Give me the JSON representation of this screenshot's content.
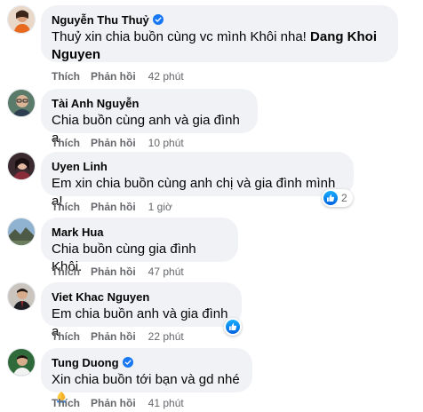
{
  "ui": {
    "like_label": "Thích",
    "reply_label": "Phản hồi"
  },
  "colors": {
    "bubble": "#f0f2f5",
    "meta": "#65676b",
    "verified": "#1877f2"
  },
  "comments": [
    {
      "name": "Nguyễn Thu Thuỷ",
      "verified": true,
      "text_before": "Thuỷ xin chia buồn cùng vc mình Khôi nha! ",
      "mention_line1": "Dang Khoi",
      "mention_line2": "Nguyen",
      "time": "42 phút",
      "avatar": "woman-orange-dress-avatar"
    },
    {
      "name": "Tài Anh Nguyễn",
      "verified": false,
      "text": "Chia buồn cùng anh và gia đình ạ",
      "time": "10 phút",
      "avatar": "man-glasses-avatar"
    },
    {
      "name": "Uyen Linh",
      "verified": false,
      "text": "Em xin chia buồn cùng anh chị và gia đình mình ạ!",
      "time": "1 giờ",
      "reaction_count": "2",
      "avatar": "woman-singer-avatar"
    },
    {
      "name": "Mark Hua",
      "verified": false,
      "text": "Chia buồn cùng gia đình Khôi.",
      "time": "47 phút",
      "avatar": "landscape-avatar"
    },
    {
      "name": "Viet Khac Nguyen",
      "verified": false,
      "text": "Em chia buồn anh và gia đình ạ",
      "time": "22 phút",
      "has_reaction": true,
      "avatar": "man-suit-avatar"
    },
    {
      "name": "Tung Duong",
      "verified": true,
      "text": "Xin chia buồn tới bạn và gd nhé",
      "time": "41 phút",
      "emoji": "folded-hands-emoji",
      "avatar": "man-singer-avatar"
    }
  ]
}
